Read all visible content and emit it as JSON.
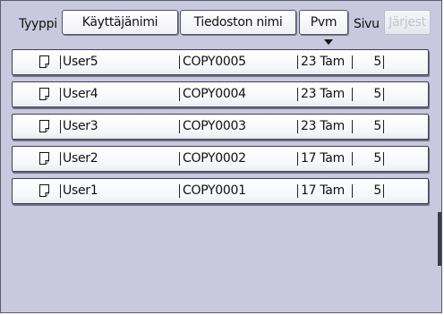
{
  "header": {
    "type_label": "Tyyppi",
    "sort_buttons": [
      "Käyttäjänimi",
      "Tiedoston nimi",
      "Pvm"
    ],
    "page_label": "Sivu",
    "order_button": "Järjest",
    "order_button_enabled": false,
    "active_sort": "Pvm"
  },
  "files": [
    {
      "icon": "document-icon",
      "user": "User5",
      "file": "COPY0005",
      "date": "23 Tam",
      "pages": "5"
    },
    {
      "icon": "document-icon",
      "user": "User4",
      "file": "COPY0004",
      "date": "23 Tam",
      "pages": "5"
    },
    {
      "icon": "document-icon",
      "user": "User3",
      "file": "COPY0003",
      "date": "23 Tam",
      "pages": "5"
    },
    {
      "icon": "document-icon",
      "user": "User2",
      "file": "COPY0002",
      "date": "17 Tam",
      "pages": "5"
    },
    {
      "icon": "document-icon",
      "user": "User1",
      "file": "COPY0001",
      "date": "17 Tam",
      "pages": "5"
    }
  ],
  "colors": {
    "panel_background": "#c9c9de",
    "row_background": "#ffffff",
    "border": "#3e3e52"
  }
}
